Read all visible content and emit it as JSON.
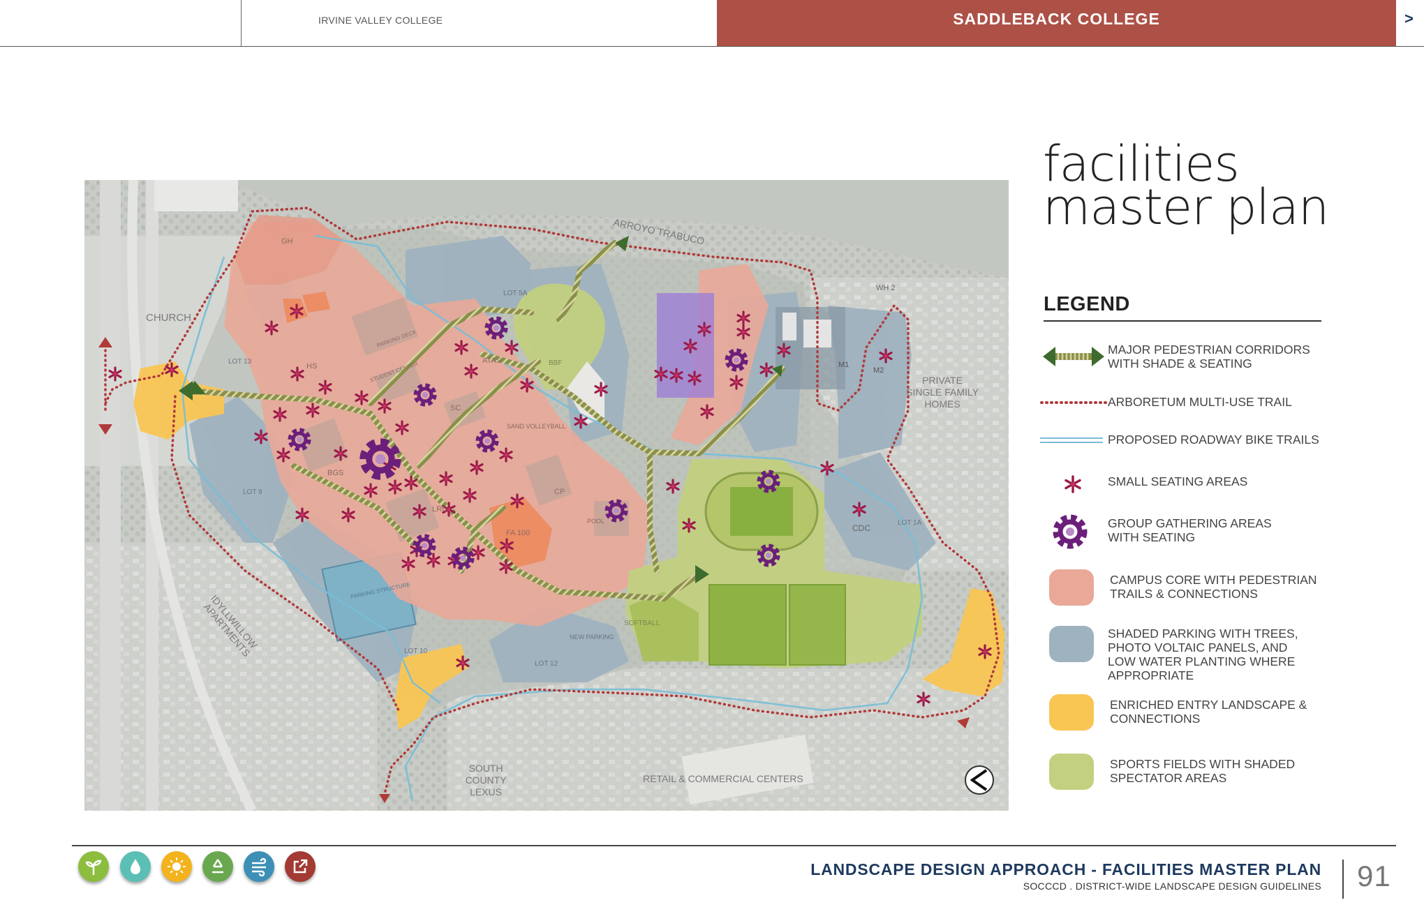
{
  "header": {
    "tab_ivc": "IRVINE VALLEY COLLEGE",
    "tab_saddleback": "SADDLEBACK COLLEGE",
    "next_arrow": ">",
    "accent_color": "#ad5147"
  },
  "title": {
    "line1": "facilities",
    "line2": "master plan"
  },
  "map": {
    "labels": {
      "church": "CHURCH",
      "arroyo": "ARROYO TRABUCO",
      "private1": "PRIVATE",
      "private2": "SINGLE FAMILY",
      "private3": "HOMES",
      "idyll1": "IDYLLWILLOW",
      "idyll2": "APARTMENTS",
      "south1": "SOUTH",
      "south2": "COUNTY",
      "south3": "LEXUS",
      "retail": "RETAIL & COMMERCIAL CENTERS",
      "wh2": "WH 2",
      "cdc": "CDC",
      "lot13": "LOT 13",
      "lot9": "LOT 9",
      "lot10": "LOT 10",
      "lot12": "LOT 12",
      "lot5a": "LOT 5A",
      "lot1a": "LOT 1A",
      "m1": "M1",
      "m2": "M2",
      "gh": "GH",
      "hs": "HS",
      "bgs": "BGS",
      "lrc": "LRC",
      "fa100": "FA 100",
      "cp": "CP",
      "sc": "SC",
      "atas": "ATAS",
      "bbf": "BBF",
      "softball": "SOFTBALL",
      "parking_structure": "PARKING STRUCTURE",
      "new_parking": "NEW PARKING",
      "pool": "POOL",
      "sand_volleyball": "SAND VOLLEYBALL",
      "parking_deck": "PARKING DECK",
      "student_center": "STUDENT CENTER"
    }
  },
  "legend": {
    "title": "LEGEND",
    "items": [
      {
        "icon": "pedestrian-corridor-arrows",
        "line1": "MAJOR PEDESTRIAN CORRIDORS",
        "line2": "WITH SHADE & SEATING",
        "line3": "",
        "line4": ""
      },
      {
        "icon": "dotted-red-trail-line",
        "line1": "ARBORETUM MULTI-USE TRAIL",
        "line2": "",
        "line3": "",
        "line4": ""
      },
      {
        "icon": "double-blue-line",
        "line1": "PROPOSED ROADWAY BIKE TRAILS",
        "line2": "",
        "line3": "",
        "line4": ""
      },
      {
        "icon": "asterisk",
        "line1": "SMALL SEATING AREAS",
        "line2": "",
        "line3": "",
        "line4": ""
      },
      {
        "icon": "gear",
        "line1": "GROUP GATHERING AREAS",
        "line2": "WITH SEATING",
        "line3": "",
        "line4": ""
      },
      {
        "icon": "swatch",
        "color": "#e9a898",
        "line1": "CAMPUS CORE WITH PEDESTRIAN",
        "line2": "TRAILS & CONNECTIONS",
        "line3": "",
        "line4": ""
      },
      {
        "icon": "swatch",
        "color": "#9fb2bf",
        "line1": "SHADED PARKING WITH TREES,",
        "line2": "PHOTO VOLTAIC PANELS, AND",
        "line3": "LOW WATER PLANTING WHERE",
        "line4": "APPROPRIATE"
      },
      {
        "icon": "swatch",
        "color": "#f9c553",
        "line1": "ENRICHED ENTRY LANDSCAPE &",
        "line2": "CONNECTIONS",
        "line3": "",
        "line4": ""
      },
      {
        "icon": "swatch",
        "color": "#c2d07f",
        "line1": "SPORTS FIELDS WITH SHADED",
        "line2": "SPECTATOR AREAS",
        "line3": "",
        "line4": ""
      }
    ]
  },
  "footer": {
    "title": "LANDSCAPE DESIGN APPROACH - FACILITIES MASTER PLAN",
    "subtitle": "SOCCCD . DISTRICT-WIDE LANDSCAPE DESIGN GUIDELINES",
    "page_number": "91",
    "icons": [
      {
        "name": "plant-icon",
        "color": "#8cbd3f"
      },
      {
        "name": "water-drop-icon",
        "color": "#5bbfb5"
      },
      {
        "name": "sun-icon",
        "color": "#f2b31c"
      },
      {
        "name": "recycle-icon",
        "color": "#6aa84f"
      },
      {
        "name": "wind-icon",
        "color": "#3d8fb5"
      },
      {
        "name": "external-link-icon",
        "color": "#a33a33"
      }
    ]
  }
}
